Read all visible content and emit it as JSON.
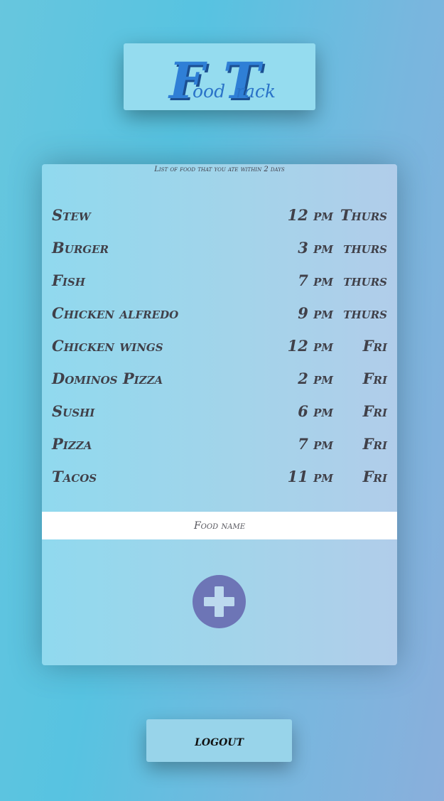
{
  "logo": {
    "word1_initial": "F",
    "word1_rest": "ood",
    "word2_initial": "T",
    "word2_rest": "rack",
    "color": "#2f7fd6"
  },
  "list_caption": "List of food that you ate within 2 days",
  "foods": [
    {
      "name": "Stew",
      "time": "12 pm",
      "day": "Thurs"
    },
    {
      "name": "Burger",
      "time": "3 pm",
      "day": "thurs"
    },
    {
      "name": "Fish",
      "time": "7 pm",
      "day": "thurs"
    },
    {
      "name": "Chicken alfredo",
      "time": "9 pm",
      "day": "thurs"
    },
    {
      "name": "Chicken wings",
      "time": "12 pm",
      "day": "Fri"
    },
    {
      "name": "Dominos Pizza",
      "time": "2 pm",
      "day": "Fri"
    },
    {
      "name": "Sushi",
      "time": "6 pm",
      "day": "Fri"
    },
    {
      "name": "Pizza",
      "time": "7 pm",
      "day": "Fri"
    },
    {
      "name": "Tacos",
      "time": "11 pm",
      "day": "Fri"
    }
  ],
  "food_input": {
    "placeholder": "Food name",
    "value": ""
  },
  "add_button": {
    "icon": "plus-icon",
    "color": "#6d75b6"
  },
  "logout_label": "logout"
}
